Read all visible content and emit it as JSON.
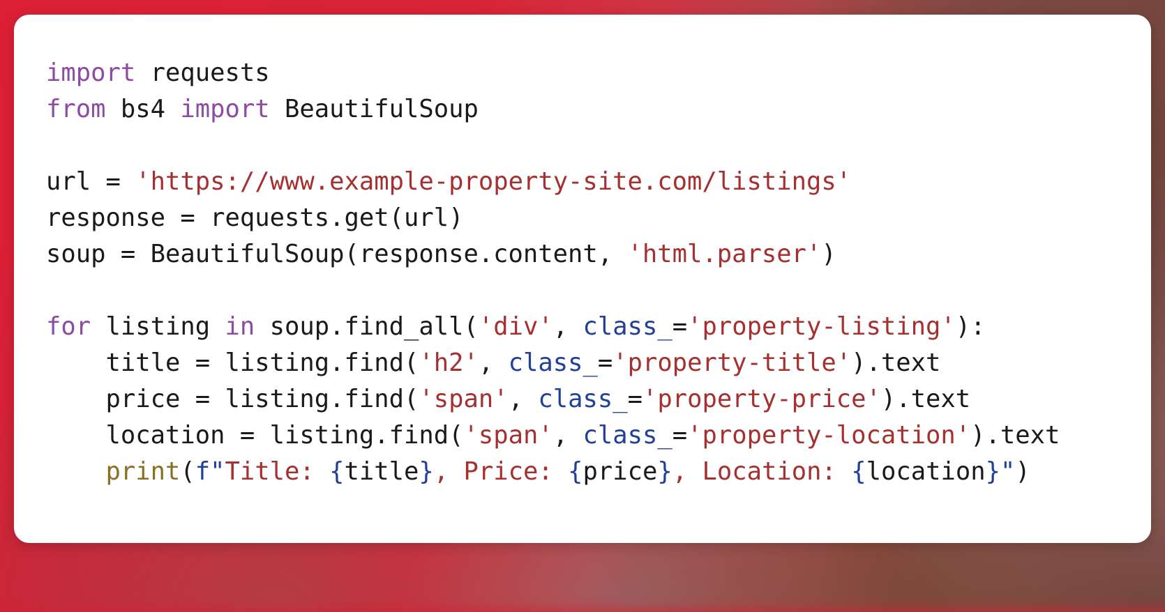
{
  "background": {
    "base_color": "#d42339",
    "accent_color": "#7d4a43",
    "description": "blurred red photographic backdrop"
  },
  "card": {
    "background_color": "#ffffff",
    "corner_radius_px": 22
  },
  "code": {
    "language": "python",
    "font_family": "monospace",
    "colors": {
      "keyword": "#8d4ba4",
      "string": "#a5302f",
      "keyword_argument": "#22409a",
      "builtin": "#8a7024",
      "fstring_markup": "#22409a",
      "plain": "#1a1a1a"
    },
    "lines": [
      {
        "index": 1,
        "text": "import requests",
        "tokens": [
          {
            "t": "import",
            "c": "kw"
          },
          {
            "t": " requests",
            "c": "plain"
          }
        ]
      },
      {
        "index": 2,
        "text": "from bs4 import BeautifulSoup",
        "tokens": [
          {
            "t": "from",
            "c": "kw"
          },
          {
            "t": " bs4 ",
            "c": "plain"
          },
          {
            "t": "import",
            "c": "kw"
          },
          {
            "t": " BeautifulSoup",
            "c": "plain"
          }
        ]
      },
      {
        "index": 3,
        "text": "",
        "tokens": []
      },
      {
        "index": 4,
        "text": "url = 'https://www.example-property-site.com/listings'",
        "tokens": [
          {
            "t": "url = ",
            "c": "plain"
          },
          {
            "t": "'https://www.example-property-site.com/listings'",
            "c": "str"
          }
        ]
      },
      {
        "index": 5,
        "text": "response = requests.get(url)",
        "tokens": [
          {
            "t": "response = requests.get(url)",
            "c": "plain"
          }
        ]
      },
      {
        "index": 6,
        "text": "soup = BeautifulSoup(response.content, 'html.parser')",
        "tokens": [
          {
            "t": "soup = BeautifulSoup(response.content, ",
            "c": "plain"
          },
          {
            "t": "'html.parser'",
            "c": "str"
          },
          {
            "t": ")",
            "c": "plain"
          }
        ]
      },
      {
        "index": 7,
        "text": "",
        "tokens": []
      },
      {
        "index": 8,
        "text": "for listing in soup.find_all('div', class_='property-listing'):",
        "tokens": [
          {
            "t": "for",
            "c": "kw"
          },
          {
            "t": " listing ",
            "c": "plain"
          },
          {
            "t": "in",
            "c": "kw"
          },
          {
            "t": " soup.find_all(",
            "c": "plain"
          },
          {
            "t": "'div'",
            "c": "str"
          },
          {
            "t": ", ",
            "c": "plain"
          },
          {
            "t": "class_",
            "c": "kwarg"
          },
          {
            "t": "=",
            "c": "plain"
          },
          {
            "t": "'property-listing'",
            "c": "str"
          },
          {
            "t": "):",
            "c": "plain"
          }
        ]
      },
      {
        "index": 9,
        "text": "    title = listing.find('h2', class_='property-title').text",
        "tokens": [
          {
            "t": "    title = listing.find(",
            "c": "plain"
          },
          {
            "t": "'h2'",
            "c": "str"
          },
          {
            "t": ", ",
            "c": "plain"
          },
          {
            "t": "class_",
            "c": "kwarg"
          },
          {
            "t": "=",
            "c": "plain"
          },
          {
            "t": "'property-title'",
            "c": "str"
          },
          {
            "t": ").text",
            "c": "plain"
          }
        ]
      },
      {
        "index": 10,
        "text": "    price = listing.find('span', class_='property-price').text",
        "tokens": [
          {
            "t": "    price = listing.find(",
            "c": "plain"
          },
          {
            "t": "'span'",
            "c": "str"
          },
          {
            "t": ", ",
            "c": "plain"
          },
          {
            "t": "class_",
            "c": "kwarg"
          },
          {
            "t": "=",
            "c": "plain"
          },
          {
            "t": "'property-price'",
            "c": "str"
          },
          {
            "t": ").text",
            "c": "plain"
          }
        ]
      },
      {
        "index": 11,
        "text": "    location = listing.find('span', class_='property-location').text",
        "tokens": [
          {
            "t": "    location = listing.find(",
            "c": "plain"
          },
          {
            "t": "'span'",
            "c": "str"
          },
          {
            "t": ", ",
            "c": "plain"
          },
          {
            "t": "class_",
            "c": "kwarg"
          },
          {
            "t": "=",
            "c": "plain"
          },
          {
            "t": "'property-location'",
            "c": "str"
          },
          {
            "t": ").text",
            "c": "plain"
          }
        ]
      },
      {
        "index": 12,
        "text": "    print(f\"Title: {title}, Price: {price}, Location: {location}\")",
        "tokens": [
          {
            "t": "    ",
            "c": "plain"
          },
          {
            "t": "print",
            "c": "bltn"
          },
          {
            "t": "(",
            "c": "plain"
          },
          {
            "t": "f\"",
            "c": "fpre"
          },
          {
            "t": "Title: ",
            "c": "str"
          },
          {
            "t": "{",
            "c": "fpre"
          },
          {
            "t": "title",
            "c": "plain"
          },
          {
            "t": "}",
            "c": "fpre"
          },
          {
            "t": ", Price: ",
            "c": "str"
          },
          {
            "t": "{",
            "c": "fpre"
          },
          {
            "t": "price",
            "c": "plain"
          },
          {
            "t": "}",
            "c": "fpre"
          },
          {
            "t": ", Location: ",
            "c": "str"
          },
          {
            "t": "{",
            "c": "fpre"
          },
          {
            "t": "location",
            "c": "plain"
          },
          {
            "t": "}",
            "c": "fpre"
          },
          {
            "t": "\"",
            "c": "fpre"
          },
          {
            "t": ")",
            "c": "plain"
          }
        ]
      }
    ]
  }
}
